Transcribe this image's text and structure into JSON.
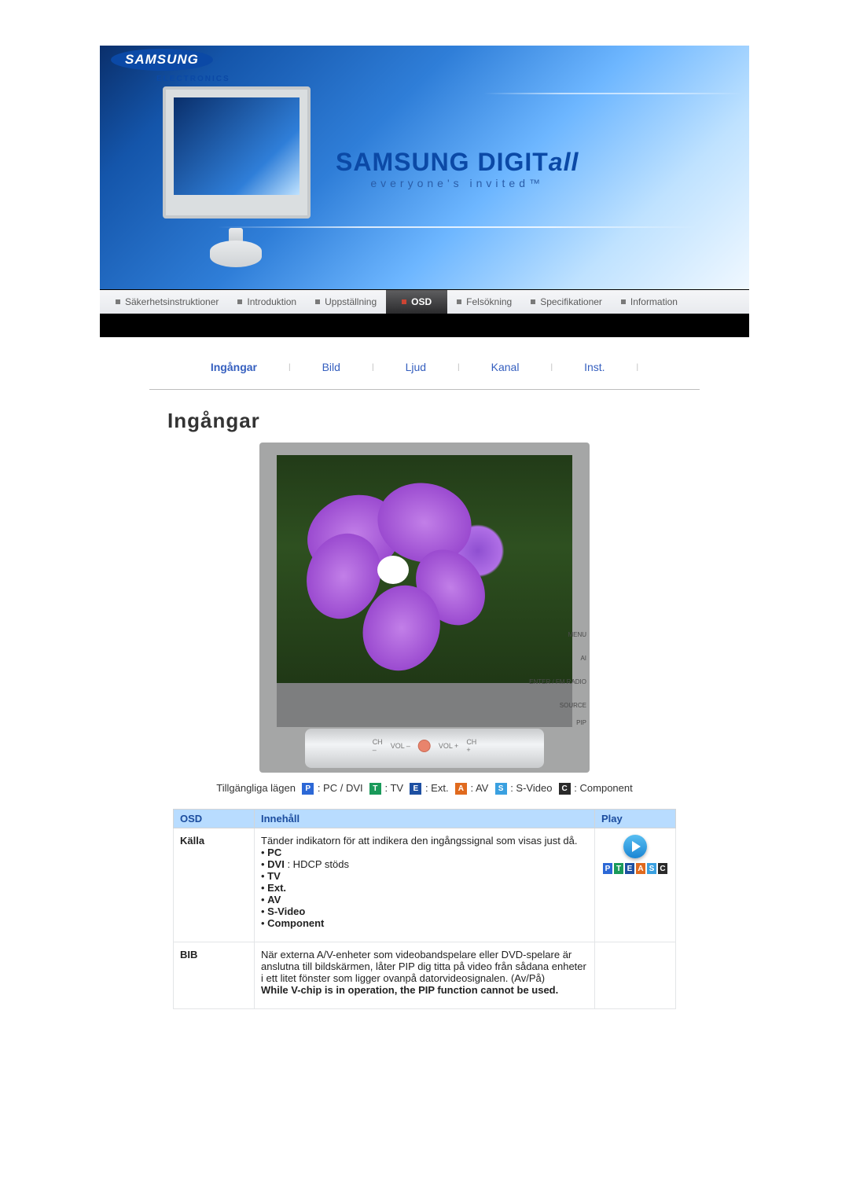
{
  "logo": {
    "brand": "SAMSUNG",
    "sub": "ELECTRONICS"
  },
  "hero": {
    "brand_prefix": "SAMSUNG DIGIT",
    "brand_ital": "all",
    "tagline": "everyone's invited™"
  },
  "mainnav": {
    "items": [
      {
        "label": "Säkerhetsinstruktioner"
      },
      {
        "label": "Introduktion"
      },
      {
        "label": "Uppställning"
      },
      {
        "label": "OSD"
      },
      {
        "label": "Felsökning"
      },
      {
        "label": "Specifikationer"
      },
      {
        "label": "Information"
      }
    ]
  },
  "subnav": {
    "items": [
      {
        "label": "Ingångar"
      },
      {
        "label": "Bild"
      },
      {
        "label": "Ljud"
      },
      {
        "label": "Kanal"
      },
      {
        "label": "Inst."
      }
    ]
  },
  "title": "Ingångar",
  "fig_controls": {
    "ch_up": "CH\n–",
    "vol_n": "VOL\n–",
    "vol_p": "VOL\n+",
    "ch_dn": "CH\n+",
    "side1": "MENU",
    "side2": "AI",
    "side3": "ENTER /\nFM RADIO",
    "side4": "SOURCE",
    "side5": "PIP"
  },
  "modes": {
    "prefix": "Tillgängliga lägen",
    "p_label": ": PC / DVI",
    "t_label": ": TV",
    "e_label": ": Ext.",
    "a_label": ": AV",
    "s_label": ": S-Video",
    "c_label": ": Component"
  },
  "table": {
    "headers": {
      "osd": "OSD",
      "content": "Innehåll",
      "play": "Play"
    },
    "rows": [
      {
        "name": "Källa",
        "desc_intro": "Tänder indikatorn för att indikera den ingångssignal som visas just då.",
        "bullets": [
          {
            "b": "PC",
            "rest": ""
          },
          {
            "b": "DVI",
            "rest": " : HDCP stöds"
          },
          {
            "b": "TV",
            "rest": ""
          },
          {
            "b": "Ext.",
            "rest": ""
          },
          {
            "b": "AV",
            "rest": ""
          },
          {
            "b": "S-Video",
            "rest": ""
          },
          {
            "b": "Component",
            "rest": ""
          }
        ]
      },
      {
        "name": "BIB",
        "desc_intro": "När externa A/V-enheter som videobandspelare eller DVD-spelare är anslutna till bildskärmen, låter PIP dig titta på video från sådana enheter i ett litet fönster som ligger ovanpå datorvideosignalen. (Av/På)",
        "bold_tail": "While V-chip is in operation, the PIP function cannot be used."
      }
    ]
  },
  "badges": {
    "P": "P",
    "T": "T",
    "E": "E",
    "A": "A",
    "S": "S",
    "C": "C"
  }
}
